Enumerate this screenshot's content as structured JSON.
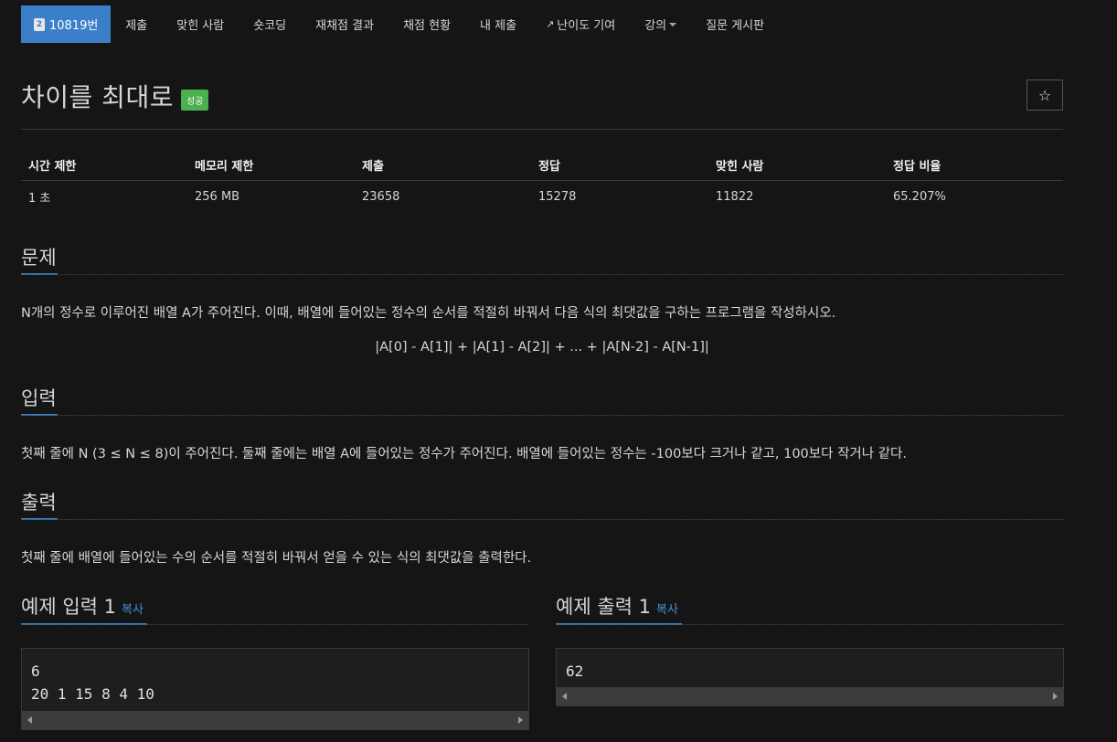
{
  "nav": {
    "problem_number": "10819번",
    "items": [
      "제출",
      "맞힌 사람",
      "숏코딩",
      "재채점 결과",
      "채점 현황",
      "내 제출",
      "난이도 기여",
      "강의"
    ],
    "last": "질문 게시판"
  },
  "problem": {
    "title": "차이를 최대로",
    "status": "성공",
    "star": "☆"
  },
  "info": {
    "headers": [
      "시간 제한",
      "메모리 제한",
      "제출",
      "정답",
      "맞힌 사람",
      "정답 비율"
    ],
    "values": [
      "1 초",
      "256 MB",
      "23658",
      "15278",
      "11822",
      "65.207%"
    ]
  },
  "sections": {
    "problem_title": "문제",
    "problem_text": "N개의 정수로 이루어진 배열 A가 주어진다. 이때, 배열에 들어있는 정수의 순서를 적절히 바꿔서 다음 식의 최댓값을 구하는 프로그램을 작성하시오.",
    "formula": "|A[0] - A[1]| + |A[1] - A[2]| + ... + |A[N-2] - A[N-1]|",
    "input_title": "입력",
    "input_text": "첫째 줄에 N (3 ≤ N ≤ 8)이 주어진다. 둘째 줄에는 배열 A에 들어있는 정수가 주어진다. 배열에 들어있는 정수는 -100보다 크거나 같고, 100보다 작거나 같다.",
    "output_title": "출력",
    "output_text": "첫째 줄에 배열에 들어있는 수의 순서를 적절히 바꿔서 얻을 수 있는 식의 최댓값을 출력한다."
  },
  "samples": {
    "input_title": "예제 입력 1",
    "output_title": "예제 출력 1",
    "copy_label": "복사",
    "input_text": "6\n20 1 15 8 4 10",
    "output_text": "62"
  },
  "colors": {
    "accent": "#3a7fc8",
    "success": "#4caf50",
    "background": "#151515"
  }
}
